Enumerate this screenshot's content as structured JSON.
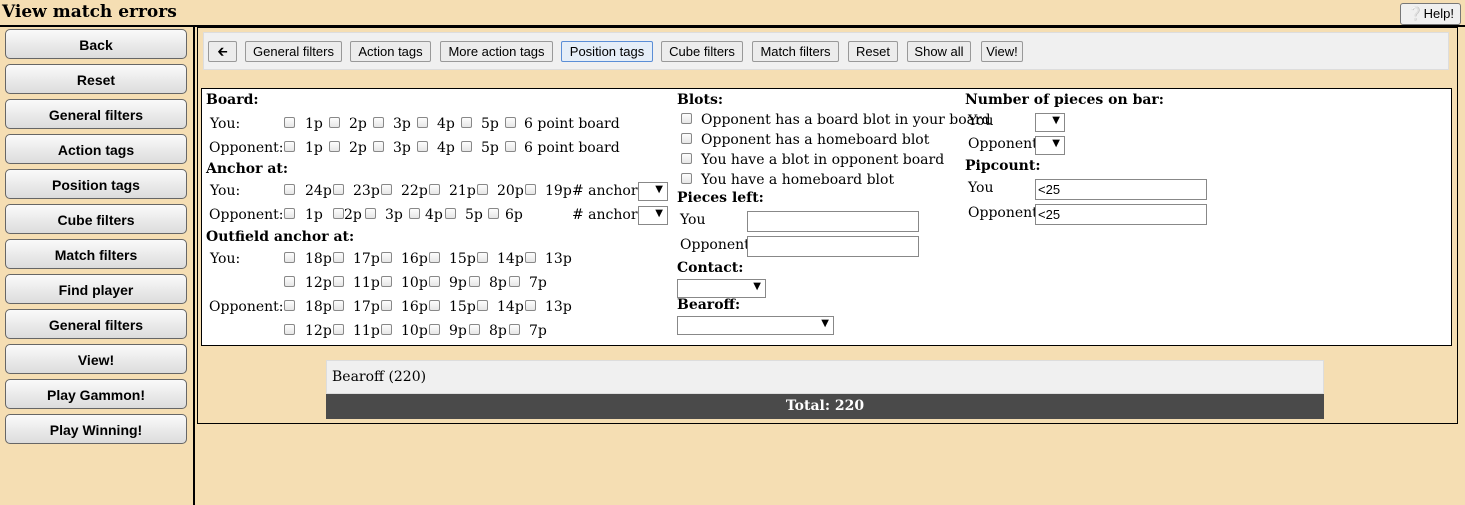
{
  "title": "View match errors",
  "help_label": "Help!",
  "sidebar": [
    "Back",
    "Reset",
    "General filters",
    "Action tags",
    "Position tags",
    "Cube filters",
    "Match filters",
    "Find player",
    "General filters",
    "View!",
    "Play Gammon!",
    "Play Winning!"
  ],
  "toolbar": [
    "General filters",
    "Action tags",
    "More action tags",
    "Position tags",
    "Cube filters",
    "Match filters",
    "Reset",
    "Show all",
    "View!"
  ],
  "board": {
    "heading": "Board:",
    "you_label": "You:",
    "opp_label": "Opponent:",
    "points": [
      "1p",
      "2p",
      "3p",
      "4p",
      "5p",
      "6 point board"
    ]
  },
  "anchor": {
    "heading": "Anchor at:",
    "you_label": "You:",
    "opp_label": "Opponent:",
    "you_points": [
      "24p",
      "23p",
      "22p",
      "21p",
      "20p",
      "19p"
    ],
    "opp_points": [
      "1p",
      "2p",
      "3p",
      "4p",
      "5p",
      "6p"
    ],
    "anchors_label": "# anchors"
  },
  "outfield": {
    "heading": "Outfield anchor at:",
    "you_label": "You:",
    "opp_label": "Opponent:",
    "row1": [
      "18p",
      "17p",
      "16p",
      "15p",
      "14p",
      "13p"
    ],
    "row2": [
      "12p",
      "11p",
      "10p",
      "9p",
      "8p",
      "7p"
    ]
  },
  "blots": {
    "heading": "Blots:",
    "items": [
      "Opponent has a board blot in your board",
      "Opponent has a homeboard blot",
      "You have a blot in opponent board",
      "You have a homeboard blot"
    ]
  },
  "pieces_left": {
    "heading": "Pieces left:",
    "you": "You",
    "opponent": "Opponent"
  },
  "contact": {
    "heading": "Contact:"
  },
  "bearoff": {
    "heading": "Bearoff:"
  },
  "bar": {
    "heading": "Number of pieces on bar:",
    "you": "You",
    "opponent": "Opponent"
  },
  "pipcount": {
    "heading": "Pipcount:",
    "you": "You",
    "opponent": "Opponent",
    "you_value": "<25",
    "opp_value": "<25"
  },
  "result": {
    "row": "Bearoff (220)",
    "total": "Total: 220"
  }
}
